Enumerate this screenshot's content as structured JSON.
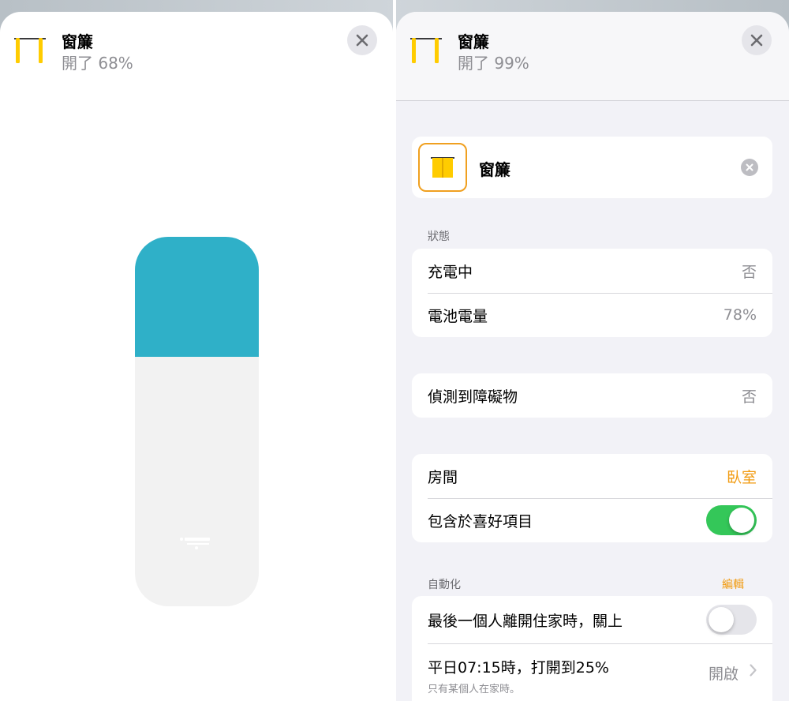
{
  "colors": {
    "accent": "#f19a0e",
    "slider_fill": "#2fb0c8",
    "toggle_on": "#34c759",
    "icon_yellow": "#ffcc00"
  },
  "left": {
    "title": "窗簾",
    "status": "開了 68%",
    "position_percent": 68,
    "slider_fill_fraction": 0.325
  },
  "right": {
    "title": "窗簾",
    "status": "開了 99%",
    "accessory_name": "窗簾",
    "status_section": {
      "label": "狀態",
      "rows": [
        {
          "label": "充電中",
          "value": "否"
        },
        {
          "label": "電池電量",
          "value": "78%"
        }
      ]
    },
    "obstruction": {
      "label": "偵測到障礙物",
      "value": "否"
    },
    "room": {
      "label": "房間",
      "value": "臥室"
    },
    "favorite": {
      "label": "包含於喜好項目",
      "on": true
    },
    "automation": {
      "label": "自動化",
      "edit_label": "編輯",
      "items": [
        {
          "label": "最後一個人離開住家時，關上",
          "on": false
        },
        {
          "label": "平日07:15時，打開到25%",
          "sub": "只有某個人在家時。",
          "value": "開啟"
        }
      ]
    }
  }
}
